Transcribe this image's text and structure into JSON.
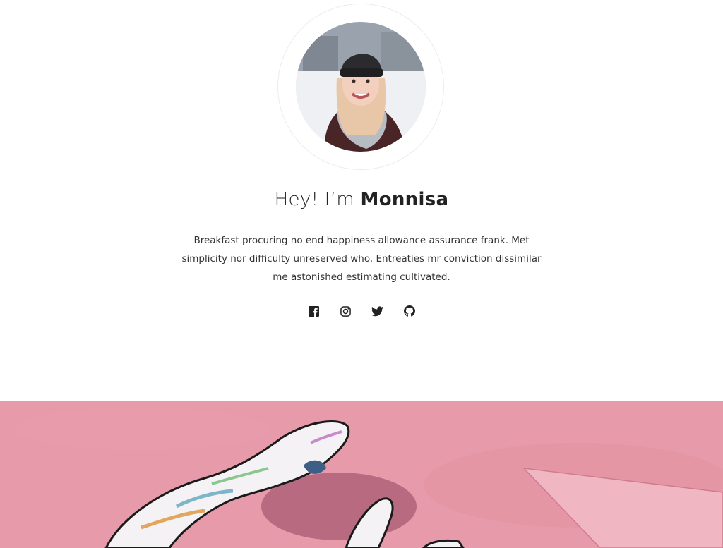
{
  "profile": {
    "greeting_prefix": "Hey! I’m ",
    "name": "Monnisa",
    "bio": "Breakfast procuring no end happiness allowance assurance frank. Met simplicity nor difficulty unreserved who. Entreaties mr conviction dissimilar me astonished estimating cultivated.",
    "avatar_icon": "profile-photo"
  },
  "social": [
    {
      "icon": "facebook-icon"
    },
    {
      "icon": "instagram-icon"
    },
    {
      "icon": "twitter-icon"
    },
    {
      "icon": "github-icon"
    }
  ],
  "hero": {
    "image": "pink-wall-mural-hand",
    "colors": {
      "wall": "#e79aa9",
      "wall_dark": "#d98497"
    }
  }
}
